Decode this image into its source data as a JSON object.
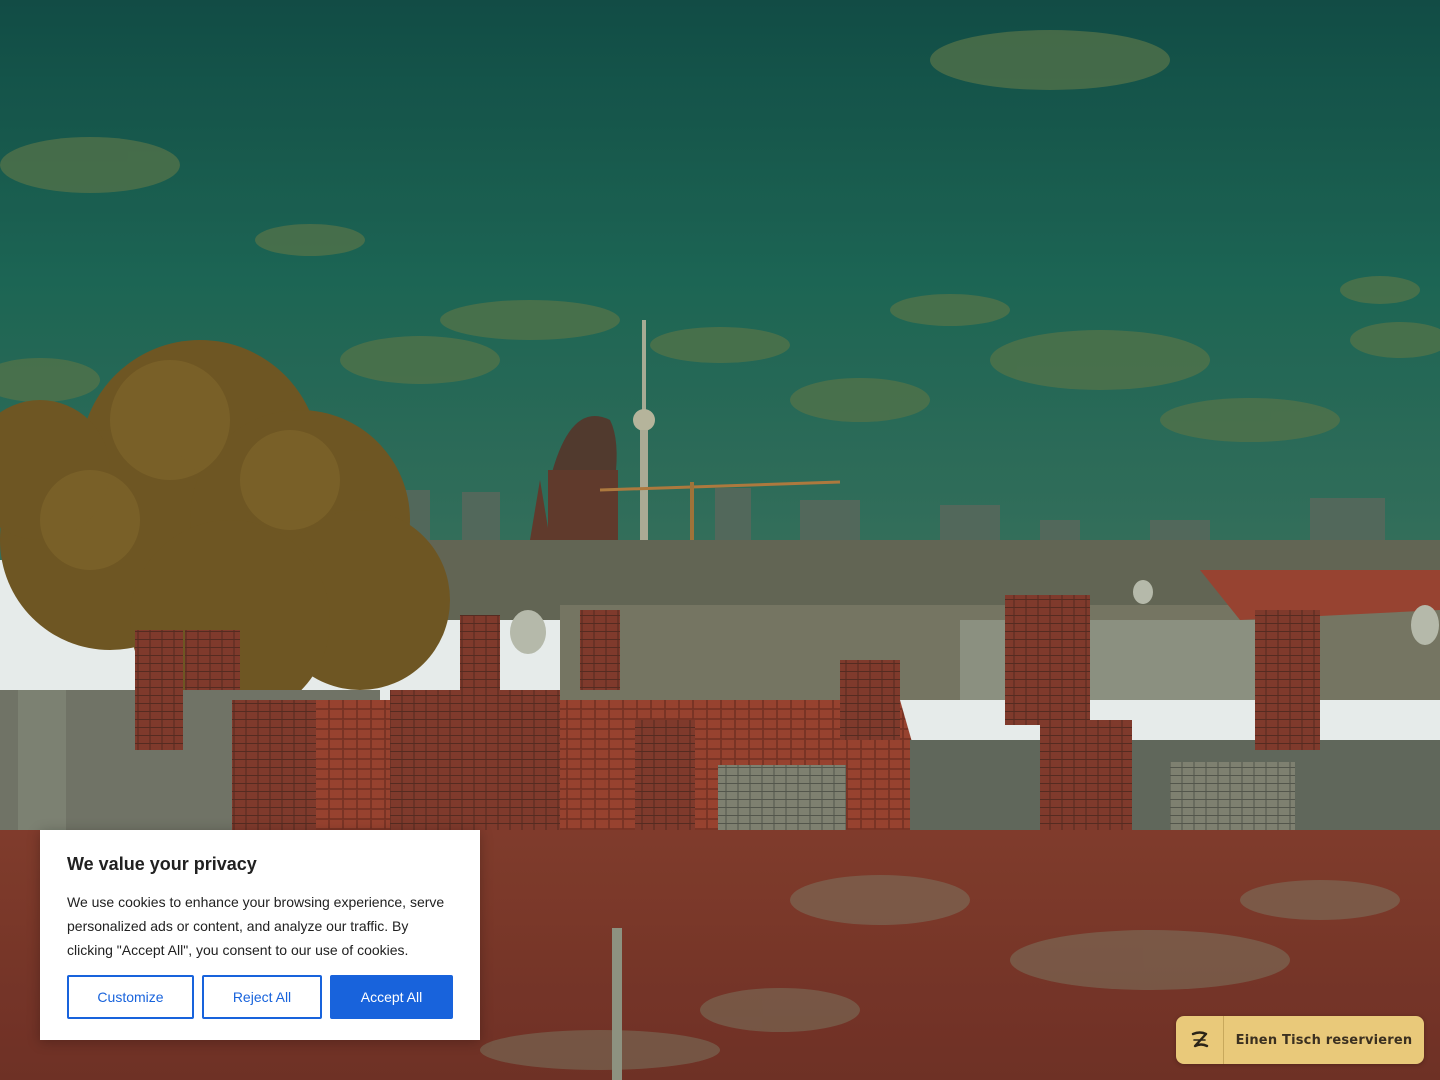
{
  "hero": {
    "image_description_icon": "berlin-rooftops-skyline-background"
  },
  "cookie_banner": {
    "title": "We value your privacy",
    "text": "We use cookies to enhance your browsing experience, serve personalized ads or content, and analyze our traffic. By clicking \"Accept All\", you consent to our use of cookies.",
    "customize_label": "Customize",
    "reject_label": "Reject All",
    "accept_label": "Accept All",
    "accent_color": "#1863dc"
  },
  "reservation": {
    "label": "Einen Tisch reservieren",
    "icon": "zenchef-logo-icon",
    "background_color": "#e9c97a"
  }
}
